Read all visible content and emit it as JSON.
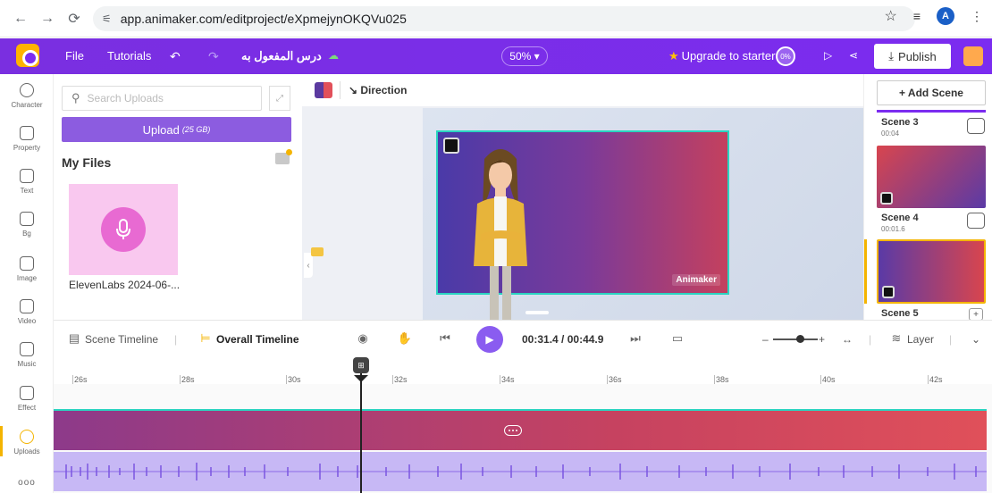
{
  "browser": {
    "url": "app.animaker.com/editproject/eXpmejynOKQVu025",
    "avatar_letter": "A"
  },
  "appbar": {
    "file": "File",
    "tutorials": "Tutorials",
    "project_name": "درس المفعول به",
    "zoom": "50%",
    "upgrade": "Upgrade to starter",
    "progress_badge": "0%",
    "publish": "Publish"
  },
  "rail": {
    "items": [
      {
        "label": "Character",
        "icon": "character-icon"
      },
      {
        "label": "Property",
        "icon": "property-icon"
      },
      {
        "label": "Text",
        "icon": "text-icon"
      },
      {
        "label": "Bg",
        "icon": "bg-icon"
      },
      {
        "label": "Image",
        "icon": "image-icon"
      },
      {
        "label": "Video",
        "icon": "video-icon"
      },
      {
        "label": "Music",
        "icon": "music-icon"
      },
      {
        "label": "Effect",
        "icon": "effect-icon"
      },
      {
        "label": "Uploads",
        "icon": "uploads-icon"
      },
      {
        "label": "ooo",
        "icon": "more-icon"
      }
    ],
    "active_color": "#f4b400"
  },
  "uploads": {
    "search_placeholder": "Search Uploads",
    "upload_label": "Upload",
    "upload_size": "(25 GB)",
    "my_files": "My Files",
    "file_name": "ElevenLabs 2024-06-..."
  },
  "canvas": {
    "direction_label": "Direction",
    "watermark": "Animaker",
    "colors": {
      "start": "#4a3aa8",
      "end": "#c4405e",
      "border": "#2ad4c0"
    }
  },
  "scenes": {
    "add_label": "+ Add Scene",
    "list": [
      {
        "name": "Scene 3",
        "time": "00:04"
      },
      {
        "name": "Scene 4",
        "time": "00:01.6"
      },
      {
        "name": "Scene 5",
        "time": ""
      }
    ]
  },
  "timeline": {
    "scene_timeline": "Scene Timeline",
    "overall_timeline": "Overall Timeline",
    "time_current": "00:31.4",
    "time_total": "00:44.9",
    "layer": "Layer",
    "ticks": [
      "26s",
      "28s",
      "30s",
      "32s",
      "34s",
      "36s",
      "38s",
      "40s",
      "42s"
    ]
  }
}
